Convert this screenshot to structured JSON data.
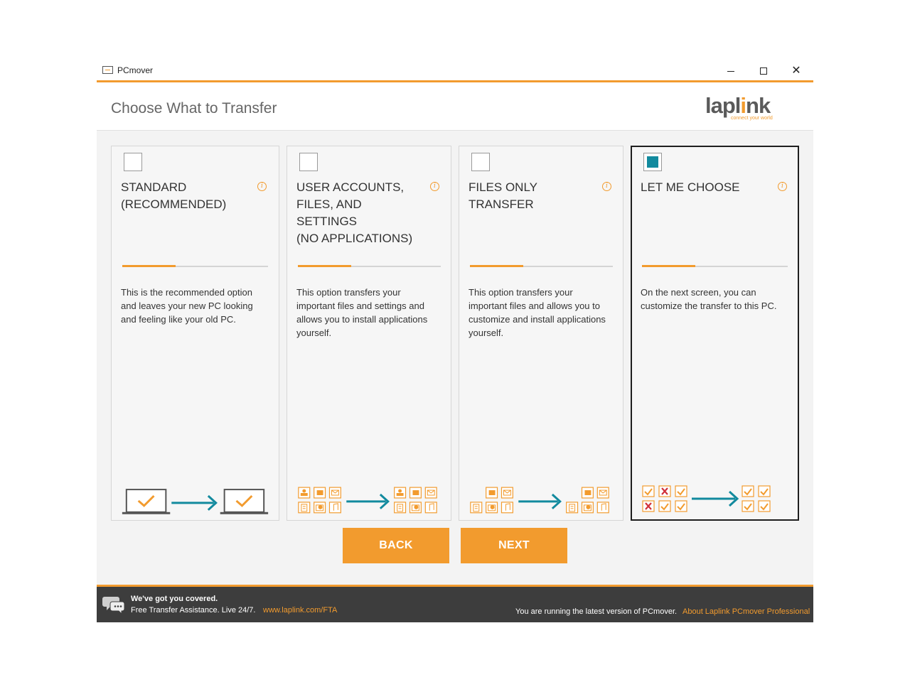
{
  "window": {
    "title": "PCmover",
    "minimize_icon": "minimize-icon",
    "maximize_icon": "maximize-icon",
    "close_icon": "close-icon"
  },
  "header": {
    "title": "Choose What to Transfer",
    "logo_text_a": "lapl",
    "logo_text_i": "i",
    "logo_text_b": "nk",
    "logo_tagline": "connect your world"
  },
  "options": [
    {
      "title_lines": [
        "STANDARD",
        "(RECOMMENDED)"
      ],
      "checked": false,
      "description_lines": [
        "This is the recommended option",
        "and leaves your new PC looking",
        "and feeling like your old PC."
      ]
    },
    {
      "title_lines": [
        "USER ACCOUNTS,",
        "FILES, AND SETTINGS",
        "(NO APPLICATIONS)"
      ],
      "checked": false,
      "description_lines": [
        "This option transfers your",
        "important files and settings and",
        "allows you to install applications",
        "yourself."
      ]
    },
    {
      "title_lines": [
        "FILES ONLY TRANSFER"
      ],
      "checked": false,
      "description_lines": [
        "This option transfers your",
        "important files and allows you to",
        "customize and install applications",
        "yourself."
      ]
    },
    {
      "title_lines": [
        "LET ME CHOOSE"
      ],
      "checked": true,
      "description_lines": [
        "On the next screen, you can",
        "customize the transfer to this PC."
      ]
    }
  ],
  "buttons": {
    "back": "BACK",
    "next": "NEXT"
  },
  "footer": {
    "covered": "We've got you covered.",
    "assist": "Free Transfer Assistance. Live 24/7.",
    "fta_link": "www.laplink.com/FTA",
    "version": "You are running the latest version of PCmover.",
    "about_link": "About Laplink PCmover Professional"
  },
  "colors": {
    "accent": "#f29b2e",
    "teal": "#128a9e",
    "footer_bg": "#3d3d3d"
  }
}
